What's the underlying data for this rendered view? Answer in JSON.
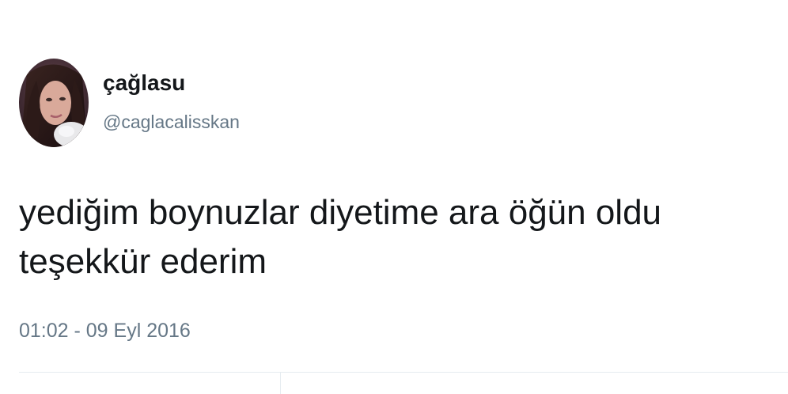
{
  "user": {
    "display_name": "çağlasu",
    "handle": "@caglacalisskan",
    "avatar_icon": "profile-photo"
  },
  "tweet": {
    "lines": [
      "yediğim boynuzlar diyetime ara öğün oldu",
      "teşekkür ederim"
    ],
    "timestamp": "01:02 - 09 Eyl 2016"
  },
  "colors": {
    "text": "#14171a",
    "secondary_text": "#657786",
    "divider": "#e6ecf0"
  }
}
